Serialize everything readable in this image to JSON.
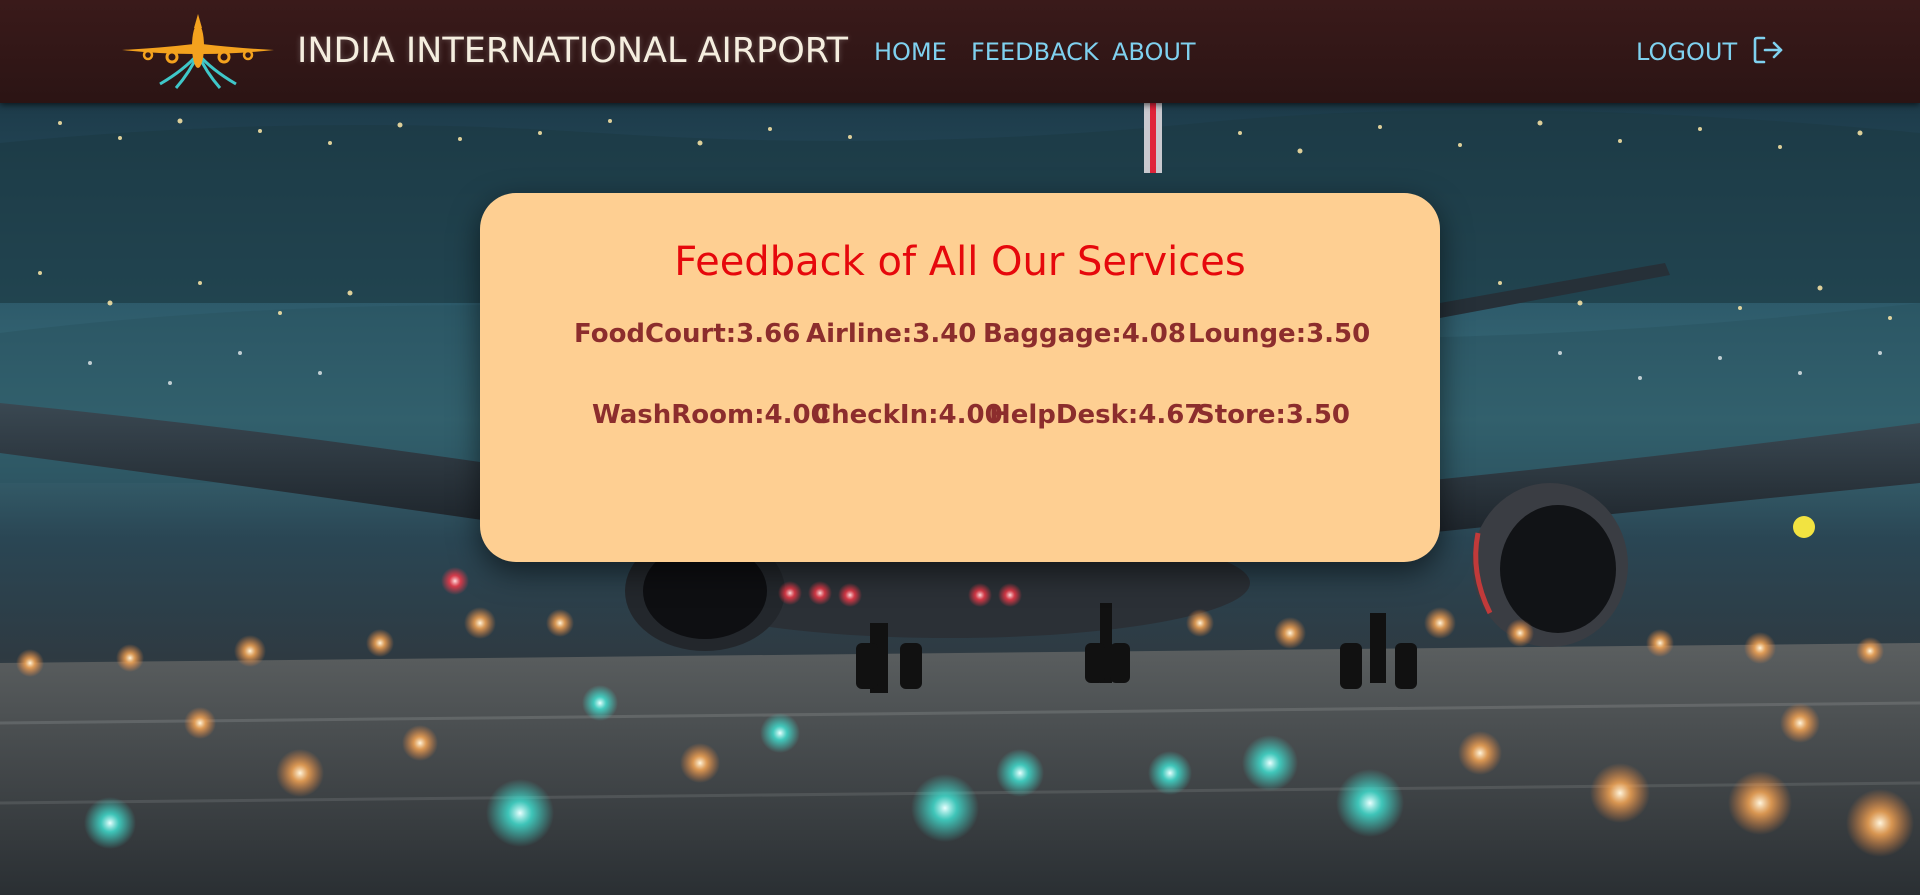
{
  "header": {
    "brand": "INDIA INTERNATIONAL AIRPORT",
    "logo_icon": "airplane-logo-icon",
    "nav": {
      "home": "HOME",
      "feedback": "FEEDBACK",
      "about": "ABOUT",
      "logout": "LOGOUT"
    },
    "logout_icon": "logout-icon"
  },
  "feedback": {
    "title": "Feedback of All Our Services",
    "row1": [
      "FoodCourt:3.66",
      "Airline:3.40",
      "Baggage:4.08",
      "Lounge:3.50"
    ],
    "row2": [
      "WashRoom:4.00",
      "CheckIn:4.00",
      "HelpDesk:4.67",
      "Store:3.50"
    ]
  },
  "colors": {
    "navbar": "#3a1a1a",
    "brand_text": "#f5eedf",
    "nav_link": "#7fd1ef",
    "card_bg": "#fecf92",
    "title": "#e6080c",
    "stat_text": "#8c2d2d"
  }
}
